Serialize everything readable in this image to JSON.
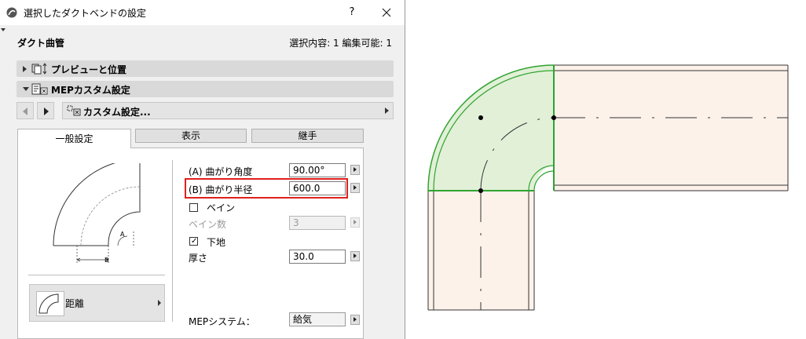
{
  "window": {
    "title": "選択したダクトベンドの設定",
    "help_label": "?"
  },
  "header": {
    "title": "ダクト曲管",
    "selection_info": "選択内容: 1 編集可能: 1"
  },
  "sections": {
    "preview": {
      "label": "プレビューと位置",
      "expanded": false
    },
    "mep_custom": {
      "label": "MEPカスタム設定",
      "expanded": true
    }
  },
  "nav": {
    "custom_label": "カスタム設定..."
  },
  "tabs": [
    {
      "label": "一般設定",
      "active": true
    },
    {
      "label": "表示",
      "active": false
    },
    {
      "label": "継手",
      "active": false
    }
  ],
  "preview_labels": {
    "a": "A",
    "b": "B"
  },
  "distance_button": {
    "label": "距離"
  },
  "params": {
    "angle": {
      "label": "(A) 曲がり角度",
      "value": "90.00°"
    },
    "radius": {
      "label": "(B) 曲がり半径",
      "value": "600.0"
    },
    "vane": {
      "label": "ベイン",
      "checked": false
    },
    "vane_count": {
      "label": "ベイン数",
      "value": "3"
    },
    "base": {
      "label": "下地",
      "checked": true
    },
    "thickness": {
      "label": "厚さ",
      "value": "30.0"
    },
    "mep_system": {
      "label": "MEPシステム：",
      "value": "給気"
    }
  },
  "colors": {
    "highlight": "#e0201c",
    "bend_fill": "#e2f0d8",
    "bend_stroke": "#2fa32f",
    "duct_fill": "#fdf2ea"
  }
}
